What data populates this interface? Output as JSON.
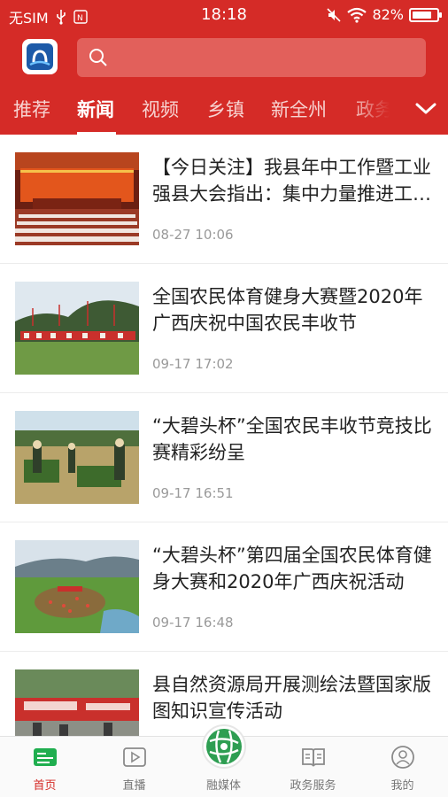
{
  "status_bar": {
    "carrier": "无SIM",
    "time": "18:18",
    "battery_text": "82%",
    "battery_level": 0.82
  },
  "search": {
    "placeholder": ""
  },
  "tabs": [
    {
      "label": "推荐"
    },
    {
      "label": "新闻"
    },
    {
      "label": "视频"
    },
    {
      "label": "乡镇"
    },
    {
      "label": "新全州"
    },
    {
      "label": "政务"
    }
  ],
  "active_tab": 1,
  "news": [
    {
      "title": "【今日关注】我县年中工作暨工业强县大会指出：集中力量推进工业强县",
      "time": "08-27 10:06",
      "image": "conference-hall-photo"
    },
    {
      "title": "全国农民体育健身大赛暨2020年广西庆祝中国农民丰收节",
      "time": "09-17 17:02",
      "image": "farm-festival-photo"
    },
    {
      "title": "“大碧头杯”全国农民丰收节竞技比赛精彩纷呈",
      "time": "09-17 16:51",
      "image": "harvest-competition-photo"
    },
    {
      "title": "“大碧头杯”第四届全国农民体育健身大赛和2020年广西庆祝活动",
      "time": "09-17 16:48",
      "image": "festival-field-photo"
    },
    {
      "title": "县自然资源局开展测绘法暨国家版图知识宣传活动",
      "time": "",
      "image": "map-publicity-photo"
    }
  ],
  "bottom_nav": [
    {
      "label": "首页",
      "icon": "home-icon"
    },
    {
      "label": "直播",
      "icon": "play-icon"
    },
    {
      "label": "融媒体",
      "icon": "globe-icon"
    },
    {
      "label": "政务服务",
      "icon": "book-icon"
    },
    {
      "label": "我的",
      "icon": "user-icon"
    }
  ],
  "colors": {
    "brand": "#d52b27",
    "nav_active": "#d52b27",
    "center_button": "#2e9e52"
  }
}
